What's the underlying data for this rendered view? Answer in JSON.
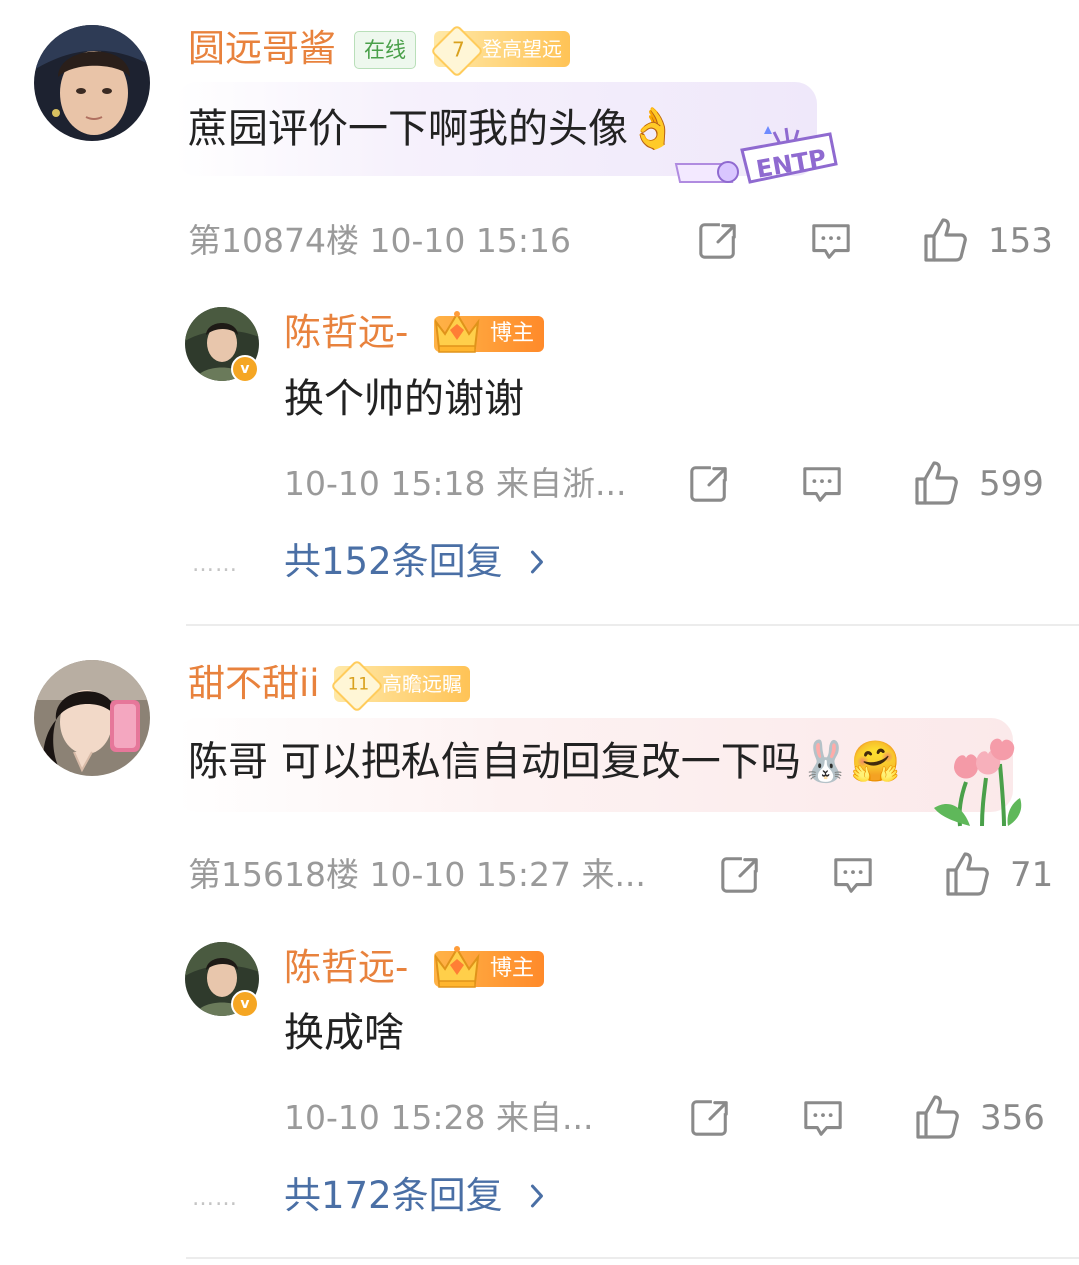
{
  "comments": [
    {
      "username": "圆远哥酱",
      "online_badge": "在线",
      "level": {
        "num": "7",
        "title": "登高望远"
      },
      "text": "蔗园评价一下啊我的头像👌",
      "floor_time": "第10874楼 10-10 15:16",
      "likes": "153",
      "bubble_sticker": "ENTP",
      "reply": {
        "username": "陈哲远-",
        "badge": "博主",
        "verified_mark": "v",
        "text": "换个帅的谢谢",
        "time_source": "10-10 15:18 来自浙...",
        "likes": "599"
      },
      "replies_link": "共152条回复",
      "replies_dots": "……"
    },
    {
      "username": "甜不甜ii",
      "level": {
        "num": "11",
        "title": "高瞻远瞩"
      },
      "text": "陈哥 可以把私信自动回复改一下吗🐰🤗",
      "floor_time": "第15618楼 10-10 15:27 来...",
      "likes": "71",
      "reply": {
        "username": "陈哲远-",
        "badge": "博主",
        "verified_mark": "v",
        "text": "换成啥",
        "time_source": "10-10 15:28 来自...",
        "likes": "356"
      },
      "replies_link": "共172条回复",
      "replies_dots": "……"
    }
  ],
  "icons": {
    "share": "share-icon",
    "comment": "comment-icon",
    "like": "like-icon",
    "chevron": "chevron-right-icon"
  },
  "colors": {
    "username": "#e8823d",
    "link": "#4a6fa5",
    "meta": "#9a9a9a"
  }
}
